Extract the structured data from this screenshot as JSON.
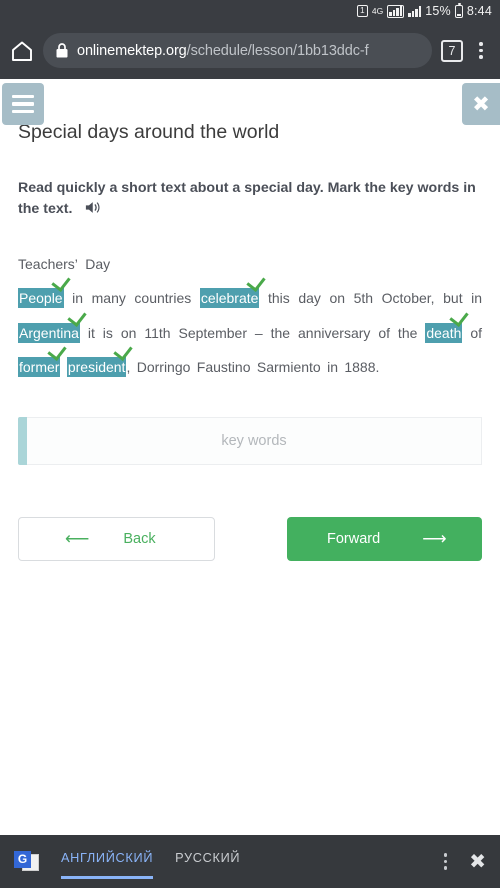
{
  "status_bar": {
    "notification_badge": "1",
    "network_type": "4G",
    "battery_percent": "15%",
    "time": "8:44",
    "icons": [
      "notification-icon",
      "network-4g-icon",
      "signal-bars-icon",
      "signal-bars-secondary-icon",
      "battery-icon"
    ]
  },
  "browser": {
    "home_icon": "home-icon",
    "lock_icon": "lock-icon",
    "url_domain": "onlinemektep.org",
    "url_path": "/schedule/lesson/1bb13ddc-f",
    "tab_count": "7",
    "menu_icon": "kebab-menu-icon"
  },
  "lesson": {
    "menu_icon": "hamburger-menu-icon",
    "close_icon": "close-icon",
    "title": "Special days around the world",
    "instruction": "Read quickly a short text about a special day. Mark the key words in the text.",
    "audio_icon": "speaker-icon",
    "heading": "Teachers’  Day",
    "paragraph_tokens": [
      {
        "text": "People",
        "highlighted": true
      },
      {
        "text": "in many countries",
        "highlighted": false
      },
      {
        "text": "celebrate",
        "highlighted": true
      },
      {
        "text": "this day on 5th October, but in",
        "highlighted": false
      },
      {
        "text": "Argentina",
        "highlighted": true
      },
      {
        "text": "it is on 11th September – the anniversary of the",
        "highlighted": false
      },
      {
        "text": "death",
        "highlighted": true
      },
      {
        "text": "of",
        "highlighted": false
      },
      {
        "text": "former",
        "highlighted": true
      },
      {
        "text": "president",
        "highlighted": true
      },
      {
        "text": ", Dorringo Faustino Sarmiento in 1888.",
        "highlighted": false
      }
    ],
    "answer_placeholder": "key words",
    "back_label": "Back",
    "back_arrow": "arrow-left-icon",
    "forward_label": "Forward",
    "forward_arrow": "arrow-right-icon",
    "colors": {
      "highlight": "#4e9fae",
      "checkmark": "#4aa94a",
      "forward_button": "#43b05f",
      "menu_button": "#a6bdc7"
    }
  },
  "translate_bar": {
    "brand_icon": "google-translate-icon",
    "brand_letter": "G",
    "source_language": "АНГЛИЙСКИЙ",
    "target_language": "РУССКИЙ",
    "menu_icon": "kebab-menu-icon",
    "close_icon": "close-icon",
    "accent_color": "#8ab4f8"
  }
}
